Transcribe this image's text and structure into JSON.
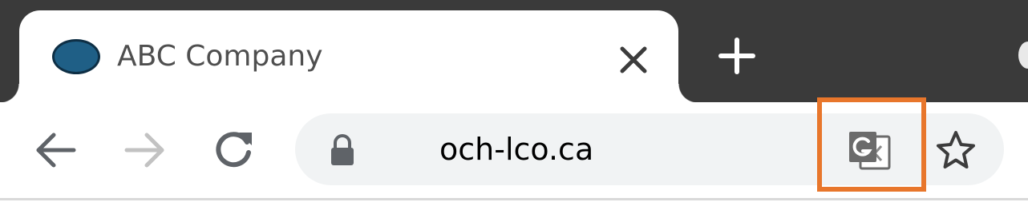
{
  "tab": {
    "title": "ABC Company",
    "favicon_color": "#1f5f86",
    "close_icon": "close-icon"
  },
  "tabstrip": {
    "new_tab_icon": "plus-icon",
    "background_color": "#3a3a3a"
  },
  "toolbar": {
    "back_icon": "arrow-left-icon",
    "forward_icon": "arrow-right-icon",
    "forward_enabled": false,
    "reload_icon": "reload-icon"
  },
  "omnibox": {
    "lock_icon": "lock-icon",
    "url": "och-lco.ca",
    "translate_icon": "translate-icon",
    "bookmark_icon": "star-icon"
  },
  "highlight": {
    "target": "translate-button",
    "color": "#e8762b"
  }
}
